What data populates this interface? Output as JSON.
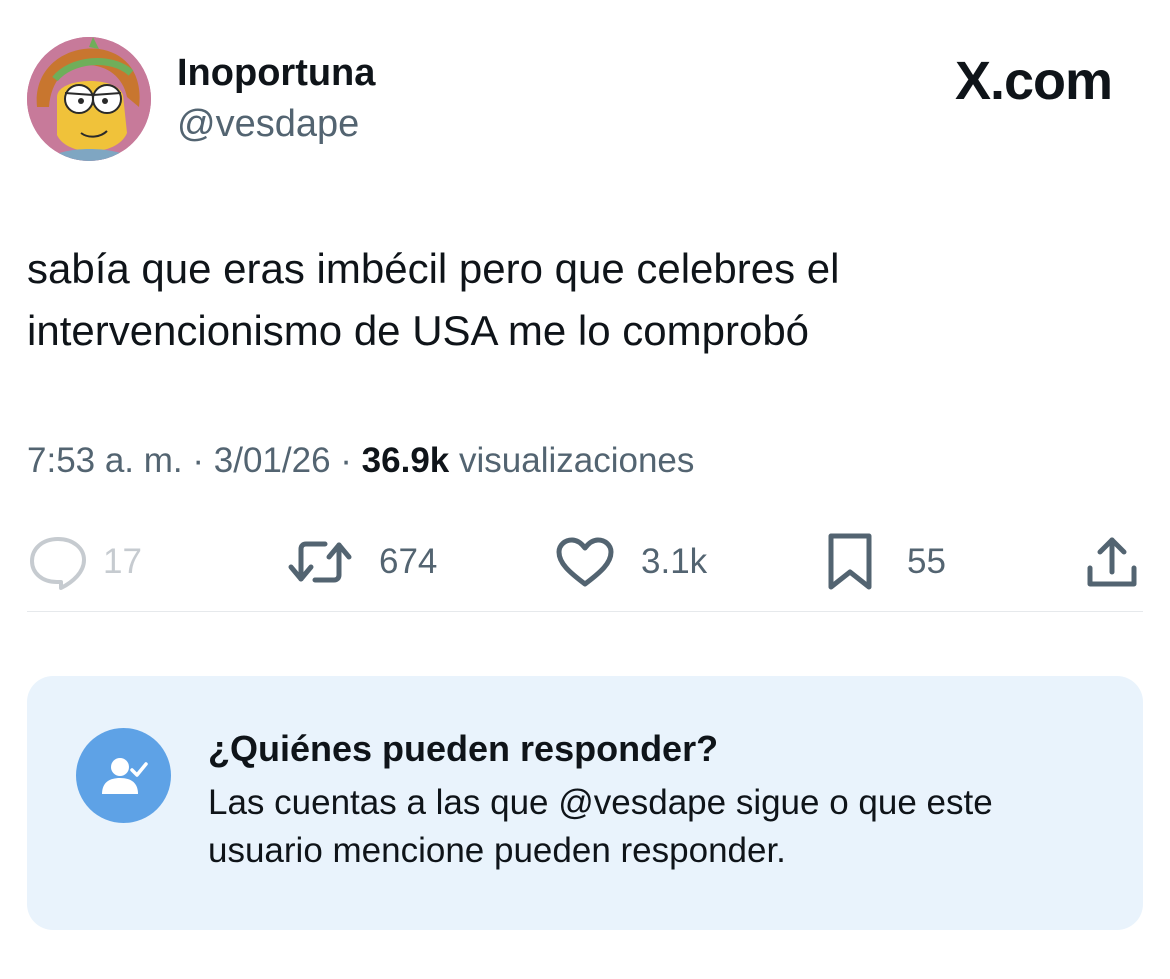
{
  "author": {
    "display_name": "Inoportuna",
    "handle": "@vesdape"
  },
  "brand": "X.com",
  "tweet": {
    "text": "sabía que eras imbécil pero que celebres el intervencionismo de USA me lo comprobó",
    "time": "7:53 a. m.",
    "separator": "·",
    "date": "3/01/26",
    "views_count": "36.9k",
    "views_label": "visualizaciones"
  },
  "actions": {
    "replies": "17",
    "reposts": "674",
    "likes": "3.1k",
    "bookmarks": "55"
  },
  "reply_settings": {
    "title": "¿Quiénes pueden responder?",
    "description": "Las cuentas a las que @vesdape sigue o que este usuario mencione pueden responder."
  },
  "icons": {
    "reply": "reply-icon",
    "repost": "repost-icon",
    "like": "heart-icon",
    "bookmark": "bookmark-icon",
    "share": "share-icon",
    "reply_settings": "user-check-icon"
  },
  "colors": {
    "text": "#0f1419",
    "secondary": "#536471",
    "reply_box_bg": "#e9f3fc",
    "reply_icon_bg": "#5ea2e6"
  }
}
